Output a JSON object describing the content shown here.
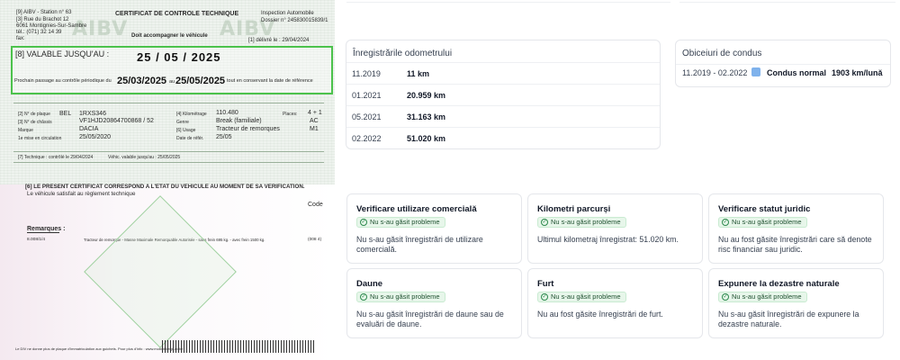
{
  "certificate": {
    "station_line": "[9] AIBV - Station n° 63",
    "address_1": "[3] Rue du Brachot 12",
    "address_2": "6061 Montignies-Sur-Sambre",
    "phone": "tél.: (071) 32 14 39",
    "fax": "fax:",
    "title": "CERTIFICAT DE CONTROLE TECHNIQUE",
    "accompany": "Doit accompagner le véhicule",
    "inspection": "Inspection Automobile",
    "dossier": "Dossier n° 245830015839/1",
    "delivered": "[1] délivré le : 29/04/2024",
    "watermark_left": "AIBV",
    "watermark_right": "AIBV",
    "valid_label": "[8] VALABLE JUSQU'AU :",
    "valid_date": "25 / 05 / 2025",
    "next_text": "Prochain passage au contrôle périodique du",
    "next_from": "25/03/2025",
    "next_au": "au",
    "next_to": "25/05/2025",
    "next_tail": "tout en conservant la date de référence",
    "plate_label": "[2] N° de plaque",
    "plate_country": "BEL",
    "plate_value": "1RXS346",
    "chassis_label": "[3] N° de châssis",
    "chassis_value": "VF1HJD20864700868 / 52",
    "brand_label": "Marque",
    "brand_value": "DACIA",
    "first_reg_label": "1e mise en circulation",
    "first_reg_value": "25/05/2020",
    "km_label": "[4] Kilométrage",
    "km_value": "110.480",
    "genre_label": "Genre",
    "genre_value": "Break (familiale)",
    "usage_label": "[6] Usage",
    "usage_value": "Tracteur de remorques",
    "ref_label": "Date de référ.",
    "ref_value": "25/05",
    "places_label": "Places:",
    "places_value": "4 + 1",
    "code_ac": "AC",
    "code_m1": "M1",
    "technique_line": "[7] Technique : contrôlé le   29/04/2024",
    "technique_valid": "Véhic. valable jusqu'au :   25/05/2025",
    "conform_1": "[6] LE PRESENT CERTIFICAT CORRESPOND A L'ETAT DU VEHICULE AU MOMENT DE SA VERIFICATION.",
    "conform_2": "Le véhicule satisfait au règlement technique",
    "code_label": "Code",
    "remarks_label": "Remarques :",
    "remarks_code": "8.008/1/4",
    "remarks_text": "Tracteur de remorque - Masse Maximale Remorquable Autorisée - sans frein 695 kg. - avec frein 1500 kg.",
    "remarks_ref": "(008 4)",
    "footer_text": "Le DIV ne donne plus de plaque d'immatriculation aux guichets. Pour plus d'info : www.mobilit.belgium.be"
  },
  "odometer": {
    "title": "Înregistrările odometrului",
    "rows": [
      {
        "date": "11.2019",
        "km": "11 km"
      },
      {
        "date": "01.2021",
        "km": "20.959 km"
      },
      {
        "date": "05.2021",
        "km": "31.163 km"
      },
      {
        "date": "02.2022",
        "km": "51.020 km"
      }
    ]
  },
  "habits": {
    "title": "Obiceiuri de condus",
    "period": "11.2019 - 02.2022",
    "style": "Condus normal",
    "rate": "1903 km/lună",
    "swatch_color": "#7fb2ec"
  },
  "badge_text": "Nu s-au găsit probleme",
  "checks": [
    {
      "title": "Verificare utilizare comercială",
      "desc": "Nu s-au găsit înregistrări de utilizare comercială."
    },
    {
      "title": "Kilometri parcurși",
      "desc": "Ultimul kilometraj înregistrat: 51.020 km."
    },
    {
      "title": "Verificare statut juridic",
      "desc": "Nu au fost găsite înregistrări care să denote risc financiar sau juridic."
    },
    {
      "title": "Daune",
      "desc": "Nu s-au găsit înregistrări de daune sau de evaluări de daune."
    },
    {
      "title": "Furt",
      "desc": "Nu au fost găsite înregistrări de furt."
    },
    {
      "title": "Expunere la dezastre naturale",
      "desc": "Nu s-au găsit înregistrări de expunere la dezastre naturale."
    }
  ],
  "colors": {
    "valid_border": "#4cc24c",
    "badge_bg": "#e7f6ea",
    "badge_text": "#1f5130"
  }
}
